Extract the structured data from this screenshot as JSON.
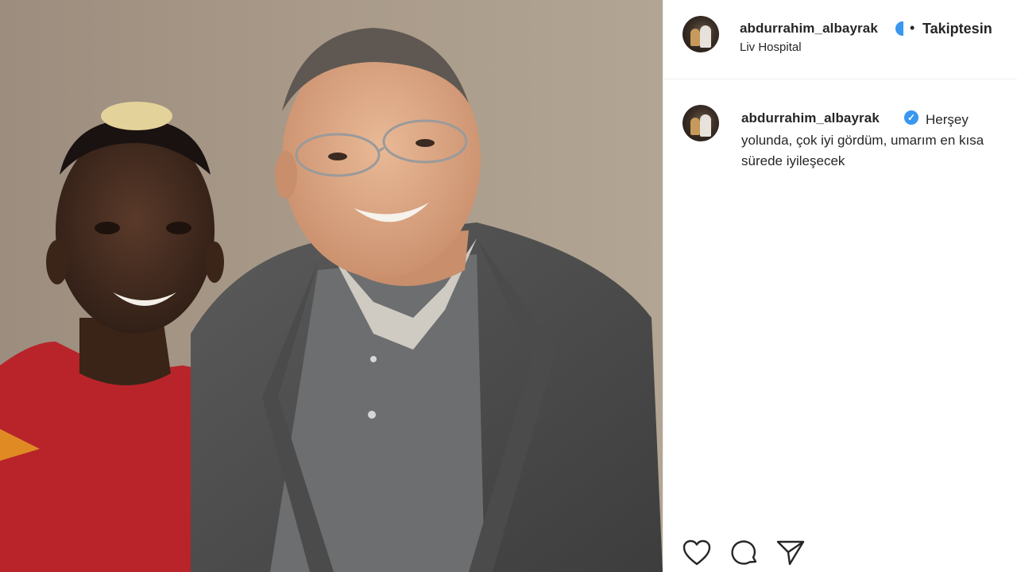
{
  "post": {
    "header": {
      "username": "abdurrahim_albayrak",
      "separator": "•",
      "follow_label": "Takiptesin",
      "location": "Liv Hospital"
    },
    "caption": {
      "username": "abdurrahim_albayrak",
      "text": "Herşey yolunda, çok iyi gördüm, umarım en kısa sürede iyileşecek"
    },
    "icons": [
      "heart-icon",
      "comment-icon",
      "share-icon",
      "verified-badge-icon"
    ],
    "colors": {
      "verified": "#3897f0",
      "text": "#262626",
      "border": "#efefef"
    }
  }
}
